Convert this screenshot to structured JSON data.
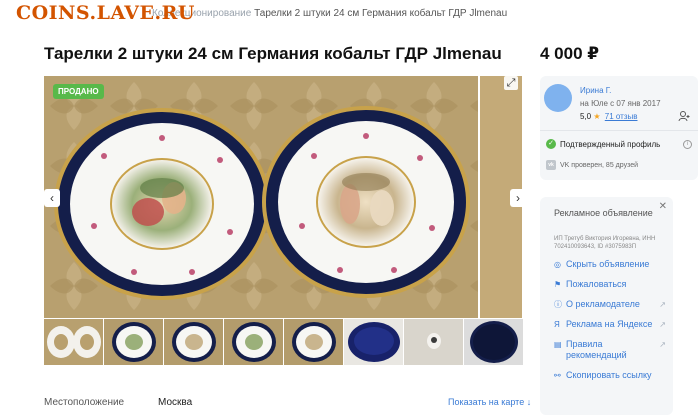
{
  "watermark": "COINS.LAVE.RU",
  "breadcrumb": {
    "prefix": "Коллекционирование",
    "text": "Тарелки 2 штуки 24 см Германия кобальт ГДР Jlmenau"
  },
  "listing": {
    "title": "Тарелки 2 штуки 24 см Германия кобальт ГДР Jlmenau",
    "price": "4 000 ₽",
    "sold_badge": "ПРОДАНО",
    "photo_count": 8
  },
  "seller": {
    "name": "Ирина Г.",
    "since": "на Юле с 07 янв 2017",
    "rating": "5,0",
    "reviews": "71 отзыв",
    "verified": "Подтвержденный профиль",
    "vk": "VK проверен, 85 друзей"
  },
  "location": {
    "label": "Местоположение",
    "value": "Москва",
    "map_link": "Показать на карте ↓"
  },
  "ad": {
    "title": "Рекламное объявление",
    "org": "ИП Третуб Виктория Игоревна, ИНН 702410093643, ID #3075983П",
    "links": [
      {
        "icon": "eye-off-icon",
        "glyph": "◎",
        "label": "Скрыть объявление",
        "arrow": false
      },
      {
        "icon": "flag-icon",
        "glyph": "⚑",
        "label": "Пожаловаться",
        "arrow": false
      },
      {
        "icon": "info-icon",
        "glyph": "ⓘ",
        "label": "О рекламодателе",
        "arrow": true
      },
      {
        "icon": "yandex-icon",
        "glyph": "Я",
        "label": "Реклама на Яндексе",
        "arrow": true
      },
      {
        "icon": "book-icon",
        "glyph": "▤",
        "label": "Правила рекомендаций",
        "arrow": true
      },
      {
        "icon": "link-icon",
        "glyph": "⚯",
        "label": "Скопировать ссылку",
        "arrow": false
      }
    ]
  },
  "colors": {
    "accent": "#3a7bd5",
    "sold": "#58b94a",
    "watermark": "#d35400",
    "cobalt": "#141e4a",
    "gold": "#c8a24a"
  }
}
